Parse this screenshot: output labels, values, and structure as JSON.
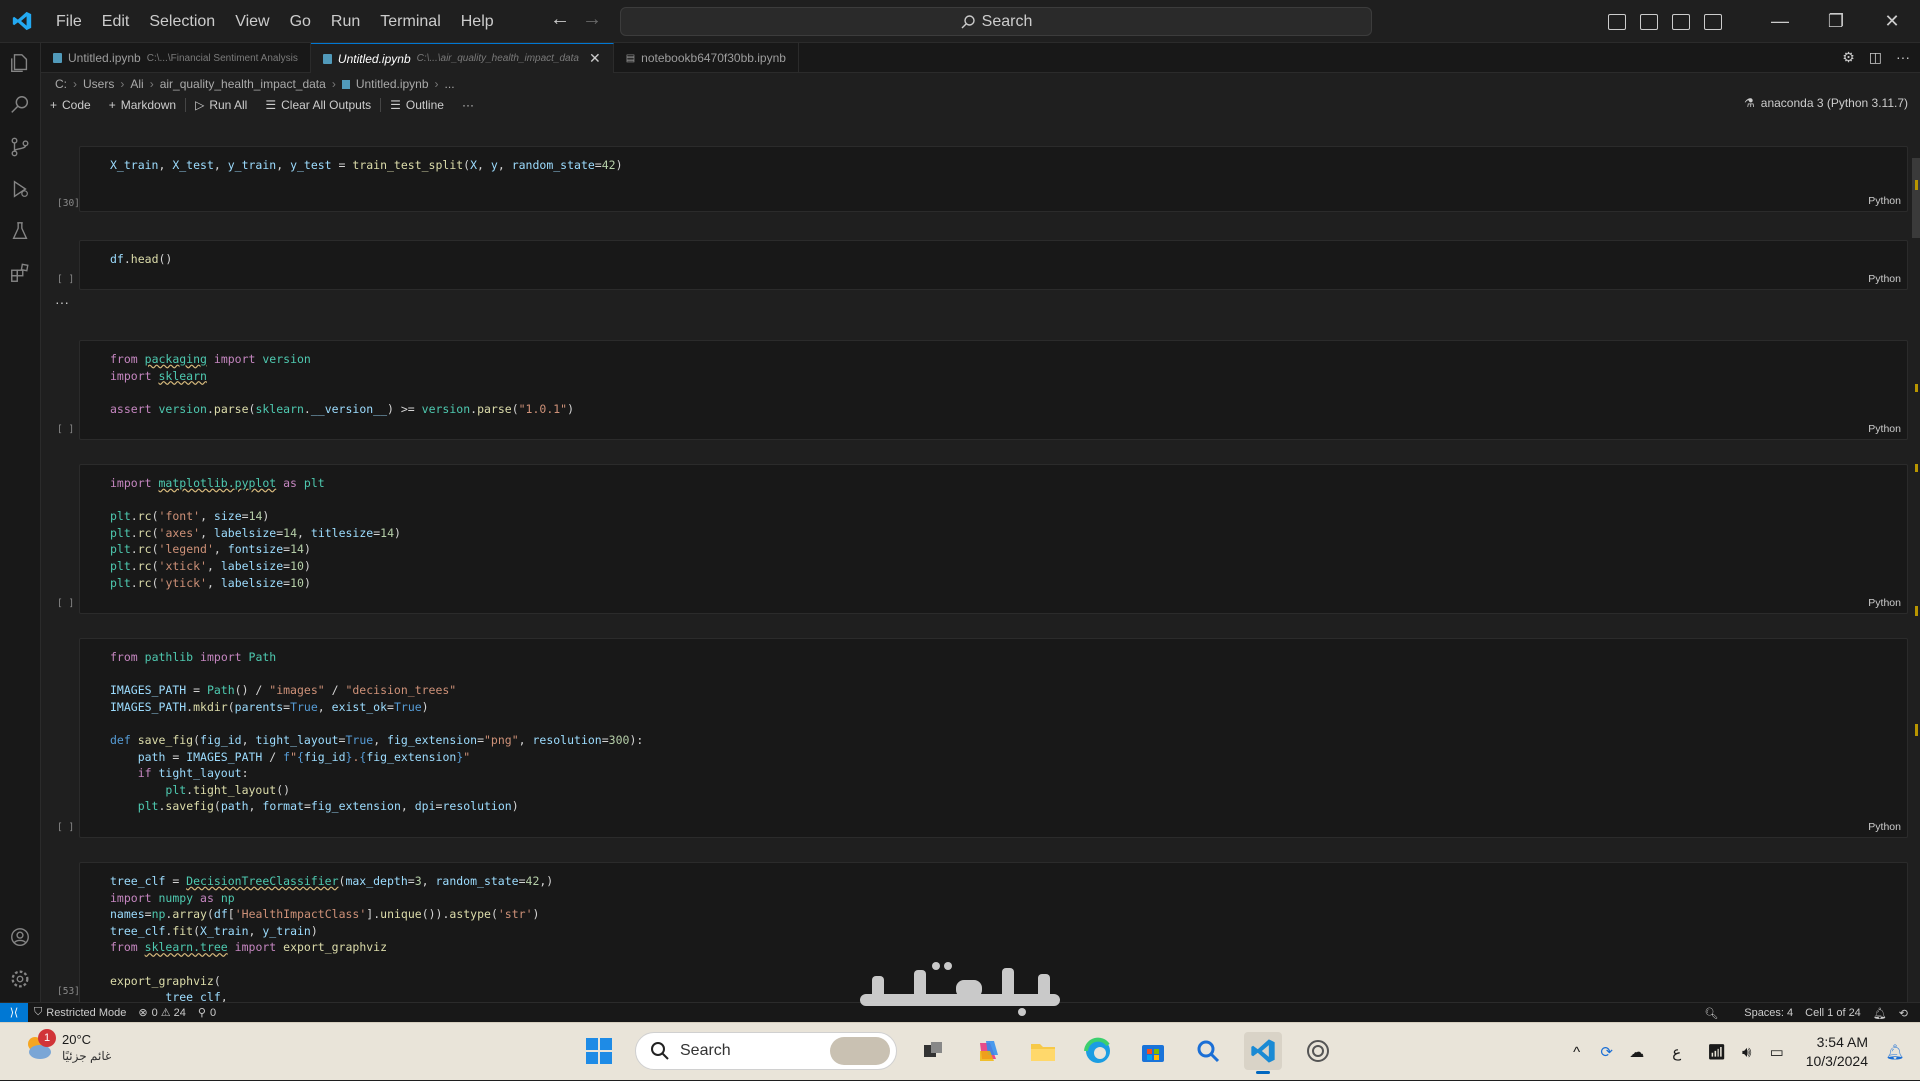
{
  "menu": [
    "File",
    "Edit",
    "Selection",
    "View",
    "Go",
    "Run",
    "Terminal",
    "Help"
  ],
  "command_center": {
    "label": "Search"
  },
  "tabs": [
    {
      "name": "Untitled.ipynb",
      "desc": "C:\\...\\Financial Sentiment Analysis"
    },
    {
      "name": "Untitled.ipynb",
      "desc": "C:\\...\\air_quality_health_impact_data"
    },
    {
      "name": "notebookb6470f30bb.ipynb",
      "desc": ""
    }
  ],
  "breadcrumb": [
    "C:",
    "Users",
    "Ali",
    "air_quality_health_impact_data",
    "Untitled.ipynb",
    "..."
  ],
  "toolbar": {
    "code": "Code",
    "markdown": "Markdown",
    "run_all": "Run All",
    "clear_outputs": "Clear All Outputs",
    "outline": "Outline",
    "more": "···"
  },
  "kernel": "anaconda 3 (Python 3.11.7)",
  "cells": [
    {
      "exec": "[30]",
      "lang": "Python"
    },
    {
      "exec": "[ ]",
      "lang": "Python"
    },
    {
      "exec": "[ ]",
      "lang": "Python"
    },
    {
      "exec": "[ ]",
      "lang": "Python"
    },
    {
      "exec": "[ ]",
      "lang": "Python"
    },
    {
      "exec": "[53]",
      "lang": ""
    }
  ],
  "statusbar": {
    "restricted": "Restricted Mode",
    "problems": "0 ⚠ 24",
    "ports": "0",
    "spaces": "Spaces: 4",
    "cell": "Cell 1 of 24"
  },
  "taskbar": {
    "temp": "20°C",
    "weather_desc": "غائم جزئيًا",
    "weather_badge": "1",
    "search": "Search",
    "lang_indicator": "ع",
    "time": "3:54 AM",
    "date": "10/3/2024"
  },
  "icons": [
    "vscode-logo-icon",
    "explorer-icon",
    "search-icon",
    "source-control-icon",
    "run-debug-icon",
    "testing-icon",
    "extensions-icon",
    "account-icon",
    "settings-gear-icon",
    "windows-start-icon",
    "edge-icon",
    "file-explorer-icon",
    "store-icon",
    "vscode-taskbar-icon"
  ],
  "colors": {
    "accent": "#0078d4",
    "editor_bg": "#1f1f1f",
    "cell_bg": "#181818",
    "taskbar_bg": "#e9e4d9"
  }
}
